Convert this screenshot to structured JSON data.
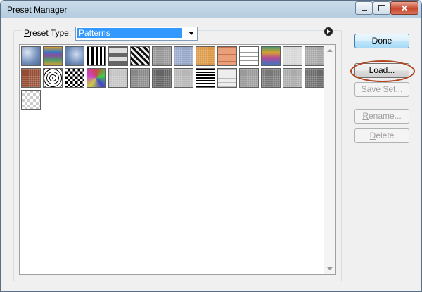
{
  "window": {
    "title": "Preset Manager"
  },
  "title_buttons": {
    "minimize": "minimize",
    "maximize": "maximize",
    "close": "close"
  },
  "preset_type": {
    "label": "Preset Type:",
    "selected": "Patterns"
  },
  "buttons": {
    "done": "Done",
    "load": "Load...",
    "save_set": "Save Set...",
    "rename": "Rename...",
    "delete": "Delete"
  },
  "patterns": [
    {
      "name": "bubbles",
      "color": "#7f9cc4"
    },
    {
      "name": "tie-dye",
      "color": "#d98a3a"
    },
    {
      "name": "blue-bubbles",
      "color": "#7896be"
    },
    {
      "name": "black-white-bars",
      "color": "#2a2a2a"
    },
    {
      "name": "gray-blocks",
      "color": "#9a9a9a"
    },
    {
      "name": "zebra",
      "color": "#505050"
    },
    {
      "name": "gray-granite",
      "color": "#8a8a8a"
    },
    {
      "name": "blue-fabric",
      "color": "#8c9cc4"
    },
    {
      "name": "orange-texture",
      "color": "#d98c30"
    },
    {
      "name": "salmon-grid",
      "color": "#e39a70"
    },
    {
      "name": "white-grid",
      "color": "#f4f4f4"
    },
    {
      "name": "rainbow",
      "color": "#c46a9a"
    },
    {
      "name": "speckle",
      "color": "#d2d2d2"
    },
    {
      "name": "stone",
      "color": "#9c9c9c"
    },
    {
      "name": "rust",
      "color": "#8a3a1e"
    },
    {
      "name": "concentric-squares",
      "color": "#e0e0e0"
    },
    {
      "name": "checkerboard",
      "color": "#333333"
    },
    {
      "name": "color-mosaic",
      "color": "#8f7fb0"
    },
    {
      "name": "clouds",
      "color": "#bdbdbd"
    },
    {
      "name": "gray-noise",
      "color": "#7c7c7c"
    },
    {
      "name": "dark-noise",
      "color": "#555555"
    },
    {
      "name": "light-noise",
      "color": "#b0b0b0"
    },
    {
      "name": "wave-lines",
      "color": "#404040"
    },
    {
      "name": "bricks",
      "color": "#dadada"
    },
    {
      "name": "marble",
      "color": "#909090"
    },
    {
      "name": "dense-noise",
      "color": "#6a6a6a"
    },
    {
      "name": "fine-noise",
      "color": "#a2a2a2"
    },
    {
      "name": "rough-noise",
      "color": "#5c5c5c"
    },
    {
      "name": "transparent-checker",
      "color": "#e6e6e6"
    }
  ]
}
